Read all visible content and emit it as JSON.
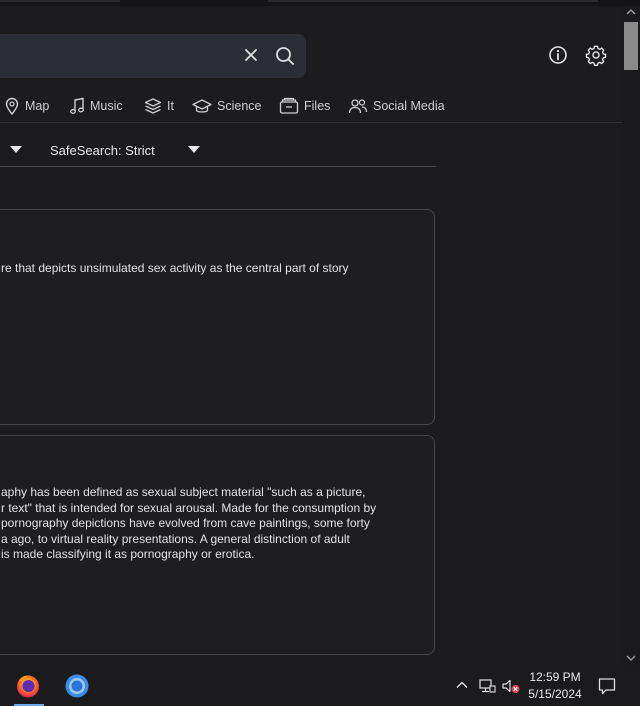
{
  "header": {
    "search": {
      "value": "",
      "clear_icon": "close-icon",
      "submit_icon": "search-icon"
    },
    "info_icon": "info-icon",
    "settings_icon": "gear-icon"
  },
  "tabs": [
    {
      "label": "Map",
      "icon": "map-pin-icon"
    },
    {
      "label": "Music",
      "icon": "music-note-icon"
    },
    {
      "label": "It",
      "icon": "layers-icon"
    },
    {
      "label": "Science",
      "icon": "graduation-cap-icon"
    },
    {
      "label": "Files",
      "icon": "files-icon"
    },
    {
      "label": "Social Media",
      "icon": "people-icon"
    }
  ],
  "filters": {
    "safesearch_label": "SafeSearch: Strict"
  },
  "results": [
    {
      "lines": [
        "re that depicts unsimulated sex activity as the central part of story"
      ]
    },
    {
      "lines": [
        "aphy has been defined as sexual subject material \"such as a picture,",
        "r text\" that is intended for sexual arousal. Made for the consumption by",
        "pornography depictions have evolved from cave paintings, some forty",
        "a ago, to virtual reality presentations. A general distinction of adult",
        "is made classifying it as pornography or erotica."
      ]
    }
  ],
  "taskbar": {
    "apps": [
      "firefox-icon",
      "chromium-icon"
    ],
    "time": "12:59 PM",
    "date": "5/15/2024"
  },
  "colors": {
    "background": "#1c1c1f",
    "search_box": "#2b2f35",
    "card_border": "#45454b",
    "taskbar": "#1b1b1d",
    "accent_active": "#6aa7e6"
  }
}
